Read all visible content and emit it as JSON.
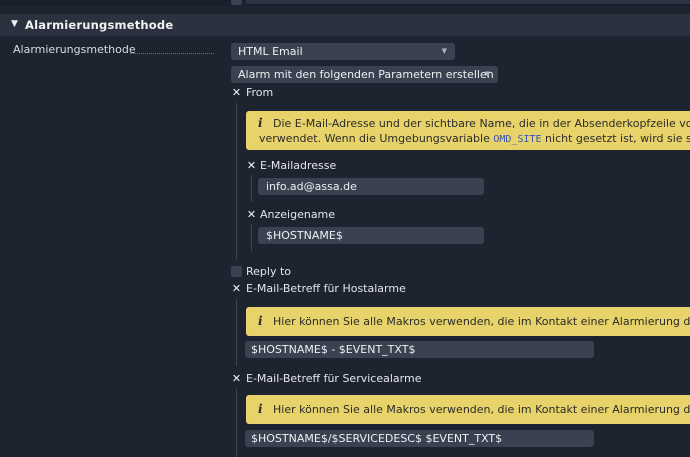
{
  "section": {
    "title": "Alarmierungsmethode"
  },
  "method": {
    "label": "Alarmierungsmethode",
    "plugin_select": "HTML Email",
    "mode_select": "Alarm mit den folgenden Parametern erstellen"
  },
  "from": {
    "label": "From",
    "checked": true,
    "info_line1": "Die E-Mail-Adresse und der sichtbare Name, die in der Absenderkopfzeile von Bena",
    "info_line2_pre": "verwendet. Wenn die Umgebungsvariable ",
    "info_code": "OMD_SITE",
    "info_line2_post": " nicht gesetzt ist, wird sie standard",
    "email_label": "E-Mailadresse",
    "email_value": "info.ad@assa.de",
    "name_label": "Anzeigename",
    "name_value": "$HOSTNAME$"
  },
  "reply_to": {
    "label": "Reply to",
    "checked": false
  },
  "host_subject": {
    "label": "E-Mail-Betreff für Hostalarme",
    "checked": true,
    "info": "Hier können Sie alle Makros verwenden, die im Kontakt einer Alarmierung definiert s",
    "value": "$HOSTNAME$ - $EVENT_TXT$"
  },
  "service_subject": {
    "label": "E-Mail-Betreff für Servicealarme",
    "checked": true,
    "info": "Hier können Sie alle Makros verwenden, die im Kontakt einer Alarmierung definiert s",
    "value": "$HOSTNAME$/$SERVICEDESC$ $EVENT_TXT$"
  },
  "icons": {
    "check": "x-check-icon",
    "info": "info-icon",
    "caret": "chevron-down-icon",
    "collapse": "triangle-down-icon"
  },
  "colors": {
    "background": "#1e2330",
    "header": "#2b313e",
    "field": "#3a4150",
    "info_box": "#e8d36a"
  }
}
